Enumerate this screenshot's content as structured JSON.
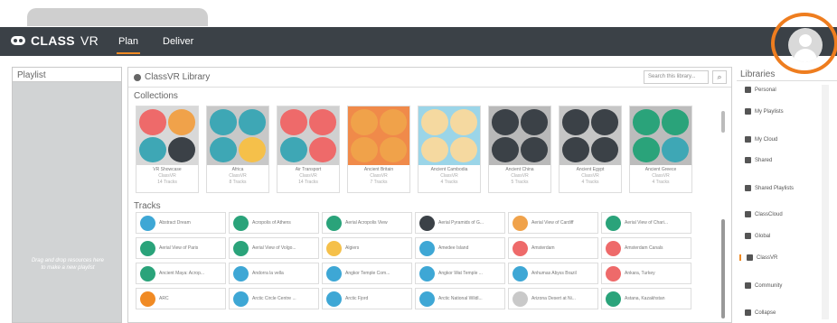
{
  "app": {
    "logo": "CLASS",
    "logo_suffix": "VR"
  },
  "nav": {
    "plan": "Plan",
    "deliver": "Deliver"
  },
  "playlist": {
    "title": "Playlist",
    "hint": "Drag and drop resources here to make a new playlist"
  },
  "library": {
    "title": "ClassVR Library",
    "search_placeholder": "Search this library...",
    "collections_label": "Collections",
    "tracks_label": "Tracks",
    "collections": [
      {
        "name": "VR Showcase",
        "owner": "ClassVR",
        "count": "14 Tracks",
        "bg": "#d8d8d8",
        "c": [
          "#ee6a6a",
          "#f0a24a",
          "#3ea7b5",
          "#3b4147"
        ]
      },
      {
        "name": "Africa",
        "owner": "ClassVR",
        "count": "8 Tracks",
        "bg": "#c8c8c8",
        "c": [
          "#3ea7b5",
          "#3ea7b5",
          "#3ea7b5",
          "#f5c04a"
        ]
      },
      {
        "name": "Air Transport",
        "owner": "ClassVR",
        "count": "14 Tracks",
        "bg": "#d0d0d0",
        "c": [
          "#ee6a6a",
          "#ee6a6a",
          "#3ea7b5",
          "#ee6a6a"
        ]
      },
      {
        "name": "Ancient Britain",
        "owner": "ClassVR",
        "count": "7 Tracks",
        "bg": "#f08a4a",
        "c": [
          "#f0a24a",
          "#f0a24a",
          "#f0a24a",
          "#f0a24a"
        ]
      },
      {
        "name": "Ancient Cambodia",
        "owner": "ClassVR",
        "count": "4 Tracks",
        "bg": "#9bd5e8",
        "c": [
          "#f5d9a0",
          "#f5d9a0",
          "#f5d9a0",
          "#f5d9a0"
        ]
      },
      {
        "name": "Ancient China",
        "owner": "ClassVR",
        "count": "5 Tracks",
        "bg": "#b9b9b9",
        "c": [
          "#3b4147",
          "#3b4147",
          "#3b4147",
          "#3b4147"
        ]
      },
      {
        "name": "Ancient Egypt",
        "owner": "ClassVR",
        "count": "4 Tracks",
        "bg": "#c6c6c6",
        "c": [
          "#3b4147",
          "#3b4147",
          "#3b4147",
          "#3b4147"
        ]
      },
      {
        "name": "Ancient Greece",
        "owner": "ClassVR",
        "count": "4 Tracks",
        "bg": "#bcbcbc",
        "c": [
          "#2aa37a",
          "#2aa37a",
          "#2aa37a",
          "#3ea7b5"
        ]
      }
    ],
    "tracks": [
      {
        "label": "Abstract Dream",
        "c": "#3ea7d5"
      },
      {
        "label": "Acropolis of Athens",
        "c": "#2aa37a"
      },
      {
        "label": "Aerial Acropolis View",
        "c": "#2aa37a"
      },
      {
        "label": "Aerial Pyramids of G...",
        "c": "#3b4147"
      },
      {
        "label": "Aerial View of Cardiff",
        "c": "#f0a24a"
      },
      {
        "label": "Aerial View of Chari...",
        "c": "#2aa37a"
      },
      {
        "label": "Aerial View of Paris",
        "c": "#2aa37a"
      },
      {
        "label": "Aerial View of Volgo...",
        "c": "#2aa37a"
      },
      {
        "label": "Algiers",
        "c": "#f5c04a"
      },
      {
        "label": "Amedee Island",
        "c": "#3ea7d5"
      },
      {
        "label": "Amsterdam",
        "c": "#ee6a6a"
      },
      {
        "label": "Amsterdam Canals",
        "c": "#ee6a6a"
      },
      {
        "label": "Ancient Maya: Acrop...",
        "c": "#2aa37a"
      },
      {
        "label": "Andorra la vella",
        "c": "#3ea7d5"
      },
      {
        "label": "Angkor Temple Com...",
        "c": "#3ea7d5"
      },
      {
        "label": "Angkor Wat Temple ...",
        "c": "#3ea7d5"
      },
      {
        "label": "Anhumas Abyss Brazil",
        "c": "#3ea7d5"
      },
      {
        "label": "Ankara, Turkey",
        "c": "#ee6a6a"
      },
      {
        "label": "ARC",
        "c": "#f08a24"
      },
      {
        "label": "Arctic Circle Centre ...",
        "c": "#3ea7d5"
      },
      {
        "label": "Arctic Fjord",
        "c": "#3ea7d5"
      },
      {
        "label": "Arctic National Wildl...",
        "c": "#3ea7d5"
      },
      {
        "label": "Arizona Desert at Ni...",
        "c": "#c9c9c9"
      },
      {
        "label": "Astana, Kazakhstan",
        "c": "#2aa37a"
      }
    ]
  },
  "libraries": {
    "title": "Libraries",
    "items": [
      {
        "label": "Personal"
      },
      {
        "label": "My Playlists"
      },
      {
        "label": "My Cloud"
      },
      {
        "label": "Shared"
      },
      {
        "label": "Shared Playlists"
      },
      {
        "label": "ClassCloud"
      },
      {
        "label": "Global"
      },
      {
        "label": "ClassVR"
      },
      {
        "label": "Community"
      },
      {
        "label": "Collapse"
      }
    ]
  }
}
